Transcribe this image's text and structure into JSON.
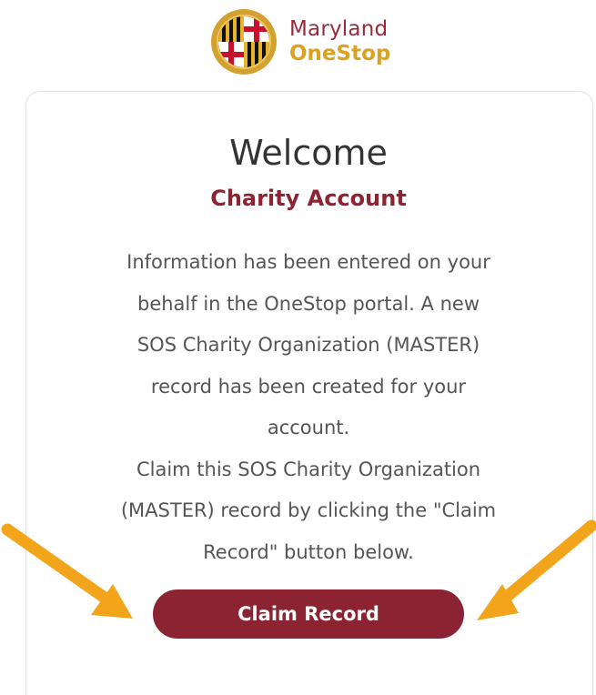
{
  "brand": {
    "logo_icon": "maryland-flag-seal",
    "line1": "Maryland",
    "line2": "OneStop",
    "colors": {
      "maroon": "#9a2a3a",
      "gold": "#d9a321"
    }
  },
  "card": {
    "title": "Welcome",
    "subtitle": "Charity Account",
    "message_lines": [
      "Information has been entered on your",
      "behalf in the OneStop portal. A new",
      "SOS Charity Organization (MASTER)",
      "record has been created for your",
      "account.",
      "Claim this SOS Charity Organization",
      "(MASTER) record by clicking the \"Claim",
      "Record\" button below."
    ],
    "button_label": "Claim Record",
    "button_color": "#8b2332"
  },
  "annotations": {
    "arrow_color": "#f2a51a",
    "arrows": [
      "left-arrow-icon",
      "right-arrow-icon"
    ]
  }
}
